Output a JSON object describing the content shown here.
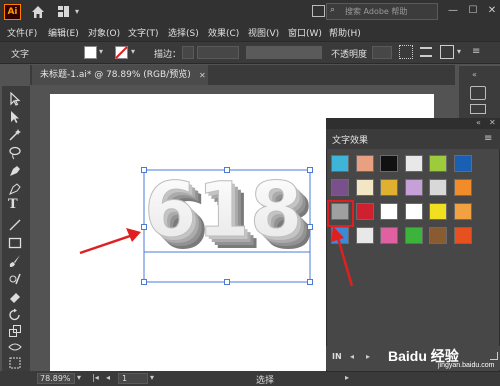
{
  "app": {
    "logo": "Ai"
  },
  "titlebar": {
    "search_placeholder": "搜索 Adobe 帮助",
    "minimize": "—",
    "maximize": "☐",
    "close": "✕"
  },
  "menu": [
    "文件(F)",
    "编辑(E)",
    "对象(O)",
    "文字(T)",
    "选择(S)",
    "效果(C)",
    "视图(V)",
    "窗口(W)",
    "帮助(H)"
  ],
  "control": {
    "object_type": "文字",
    "stroke_label": "描边：",
    "opacity_label": "不透明度"
  },
  "document": {
    "tab_title": "未标题-1.ai* @ 78.89% (RGB/预览)",
    "tab_close": "✕",
    "artwork_text": "618"
  },
  "panel": {
    "title": "文字效果",
    "menu_icon": "≡",
    "collapse": "«",
    "close": "✕",
    "library_label": "IN",
    "thumbnails": [
      "#3fb4d8",
      "#e8a080",
      "#111111",
      "#e8e8e8",
      "#9ccc3c",
      "#1a5fb4",
      "#7a4f8c",
      "#f2e6c4",
      "#e0b030",
      "#c8a0d8",
      "#d8d8d8",
      "#f28c28",
      "#a0a0a0",
      "#d02030",
      "#ffffff",
      "#ffffff",
      "#f2e020",
      "#f2a040",
      "#3a8ad8",
      "#e8e8e8",
      "#e060a0",
      "#3cb43c",
      "#8a5a30",
      "#e85020"
    ]
  },
  "status": {
    "zoom": "78.89%",
    "page": "1",
    "tool": "选择",
    "watermark_main": "Baidu 经验",
    "watermark_url": "jingyan.baidu.com"
  },
  "colors": {
    "accent_red": "#e02020",
    "selection_blue": "#4a7bd8",
    "ai_orange": "#ff9a00"
  }
}
